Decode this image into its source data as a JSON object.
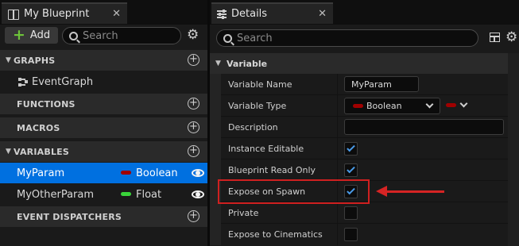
{
  "left_panel": {
    "tab_title": "My Blueprint",
    "tab_close": "✕",
    "add_label": "Add",
    "add_plus": "+",
    "search_placeholder": "Search",
    "gear_glyph": "⚙",
    "sections": {
      "graphs": {
        "label": "GRAPHS",
        "arrow": "▼",
        "add": "+"
      },
      "functions": {
        "label": "FUNCTIONS",
        "add": "+"
      },
      "macros": {
        "label": "MACROS",
        "add": "+"
      },
      "variables": {
        "label": "VARIABLES",
        "arrow": "▼",
        "add": "+"
      },
      "dispatchers": {
        "label": "EVENT DISPATCHERS",
        "add": "+"
      }
    },
    "graphs": [
      {
        "label": "EventGraph"
      }
    ],
    "variables": [
      {
        "name": "MyParam",
        "type": "Boolean",
        "type_color": "#a00000",
        "selected": true
      },
      {
        "name": "MyOtherParam",
        "type": "Float",
        "type_color": "#3ad43a",
        "selected": false
      }
    ]
  },
  "details_panel": {
    "tab_title": "Details",
    "tab_close": "✕",
    "search_placeholder": "Search",
    "gear_glyph": "⚙",
    "section": {
      "label": "Variable",
      "arrow": "▼"
    },
    "properties": {
      "variable_name": {
        "label": "Variable Name",
        "value": "MyParam"
      },
      "variable_type": {
        "label": "Variable Type",
        "value": "Boolean",
        "type_color": "#a00000"
      },
      "description": {
        "label": "Description",
        "value": ""
      },
      "instance_editable": {
        "label": "Instance Editable",
        "checked": true
      },
      "blueprint_read_only": {
        "label": "Blueprint Read Only",
        "checked": true
      },
      "expose_on_spawn": {
        "label": "Expose on Spawn",
        "checked": true
      },
      "private": {
        "label": "Private",
        "checked": false
      },
      "expose_to_cinematics": {
        "label": "Expose to Cinematics",
        "checked": false
      }
    }
  },
  "annotation": {
    "color": "#d62424"
  }
}
